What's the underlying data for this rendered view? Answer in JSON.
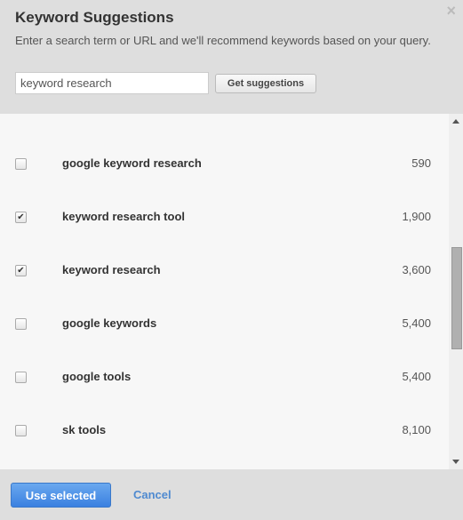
{
  "dialog": {
    "title": "Keyword Suggestions",
    "subtitle": "Enter a search term or URL and we'll recommend keywords based on your query.",
    "close_icon": "×"
  },
  "search": {
    "value": "keyword research",
    "button_label": "Get suggestions"
  },
  "keywords": [
    {
      "label": "google keyword research",
      "volume": "590",
      "checked": false
    },
    {
      "label": "keyword research tool",
      "volume": "1,900",
      "checked": true
    },
    {
      "label": "keyword research",
      "volume": "3,600",
      "checked": true
    },
    {
      "label": "google keywords",
      "volume": "5,400",
      "checked": false
    },
    {
      "label": "google tools",
      "volume": "5,400",
      "checked": false
    },
    {
      "label": "sk tools",
      "volume": "8,100",
      "checked": false
    }
  ],
  "footer": {
    "use_selected_label": "Use selected",
    "cancel_label": "Cancel"
  }
}
